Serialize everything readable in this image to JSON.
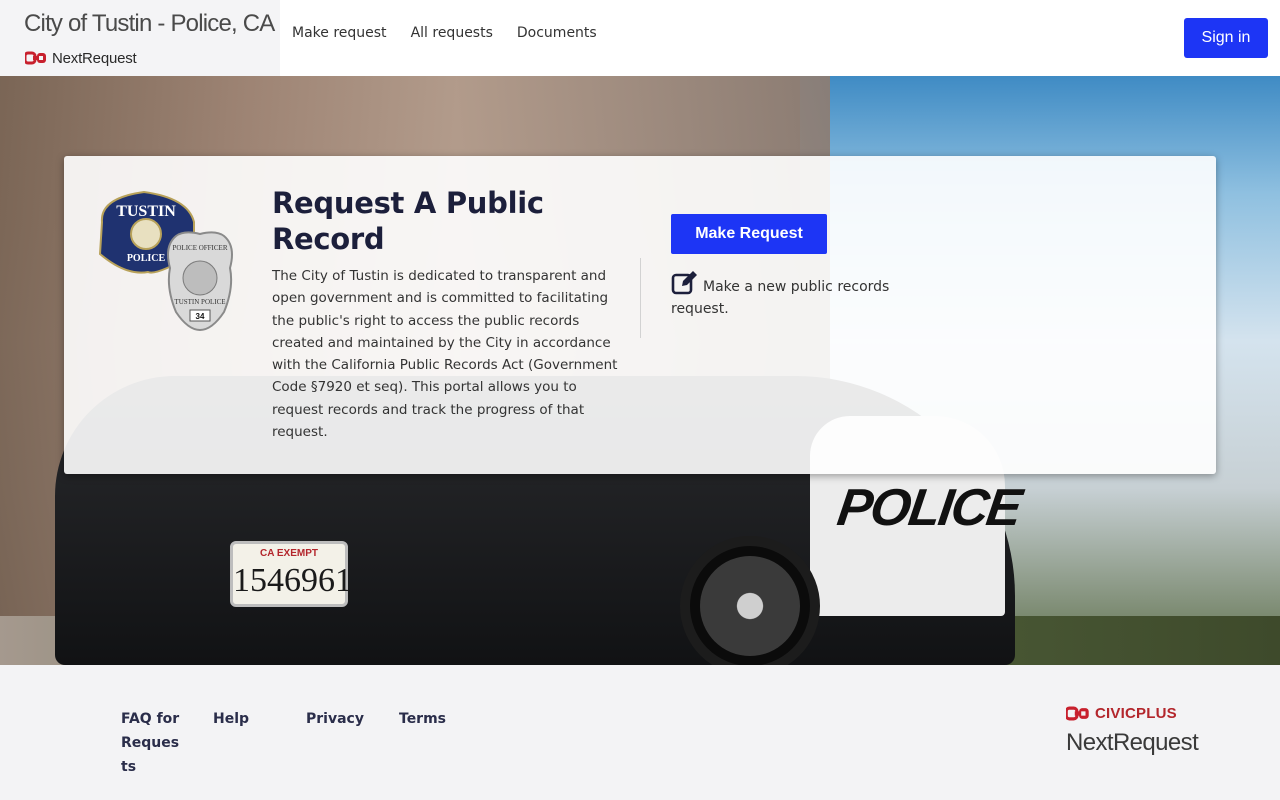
{
  "header": {
    "site_title": "City of Tustin - Police, CA",
    "brand_name": "NextRequest",
    "nav": [
      {
        "label": "Make request"
      },
      {
        "label": "All requests"
      },
      {
        "label": "Documents"
      }
    ],
    "sign_in_label": "Sign in"
  },
  "hero": {
    "plate_top": "CA EXEMPT",
    "plate_number": "1546961",
    "car_label": "POLICE"
  },
  "card": {
    "title": "Request A Public Record",
    "description": "The City of Tustin is dedicated to transparent and open government and is committed to facilitating the public's right to access the public records created and maintained by the City in accordance with the California Public Records Act (Government Code §7920 et seq). This portal allows you to request records and track the progress of that request.",
    "make_request_label": "Make Request",
    "make_request_note": "Make a new public records request.",
    "logo_text": {
      "patch_top": "TUSTIN",
      "patch_bottom": "POLICE",
      "badge_top": "POLICE OFFICER",
      "badge_bottom": "TUSTIN POLICE",
      "badge_number": "34"
    }
  },
  "footer": {
    "links": [
      {
        "label": "FAQ for Requests"
      },
      {
        "label": "Help"
      },
      {
        "label": "Privacy"
      },
      {
        "label": "Terms"
      }
    ],
    "civic_brand": "CIVICPLUS",
    "civic_product": "NextRequest"
  },
  "colors": {
    "primary_button": "#1d35f5",
    "brand_red": "#b3262c",
    "title_navy": "#1c1f3b"
  }
}
